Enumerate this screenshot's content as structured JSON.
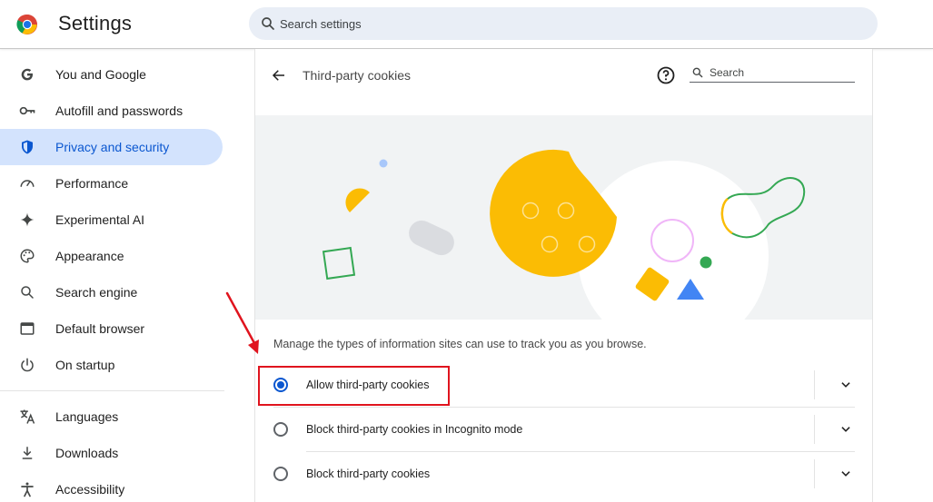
{
  "header": {
    "app_title": "Settings",
    "logo_icon": "chrome-logo-icon",
    "search_placeholder": "Search settings"
  },
  "sidebar": {
    "items": [
      {
        "label": "You and Google",
        "icon": "google-g-icon",
        "active": false
      },
      {
        "label": "Autofill and passwords",
        "icon": "key-icon",
        "active": false
      },
      {
        "label": "Privacy and security",
        "icon": "shield-icon",
        "active": true
      },
      {
        "label": "Performance",
        "icon": "speedometer-icon",
        "active": false
      },
      {
        "label": "Experimental AI",
        "icon": "sparkle-icon",
        "active": false
      },
      {
        "label": "Appearance",
        "icon": "palette-icon",
        "active": false
      },
      {
        "label": "Search engine",
        "icon": "search-icon",
        "active": false
      },
      {
        "label": "Default browser",
        "icon": "browser-window-icon",
        "active": false
      },
      {
        "label": "On startup",
        "icon": "power-icon",
        "active": false
      },
      {
        "label": "Languages",
        "icon": "translate-icon",
        "active": false
      },
      {
        "label": "Downloads",
        "icon": "download-icon",
        "active": false
      },
      {
        "label": "Accessibility",
        "icon": "accessibility-icon",
        "active": false
      }
    ]
  },
  "page": {
    "title": "Third-party cookies",
    "search_placeholder": "Search",
    "description": "Manage the types of information sites can use to track you as you browse.",
    "options": [
      {
        "label": "Allow third-party cookies",
        "selected": true
      },
      {
        "label": "Block third-party cookies in Incognito mode",
        "selected": false
      },
      {
        "label": "Block third-party cookies",
        "selected": false
      }
    ]
  },
  "colors": {
    "accent": "#0b57d0",
    "active_nav_bg": "#d3e3fd",
    "search_bg": "#e9eef6",
    "annotation_red": "#e0141e",
    "cookie_yellow": "#fbbc04"
  }
}
